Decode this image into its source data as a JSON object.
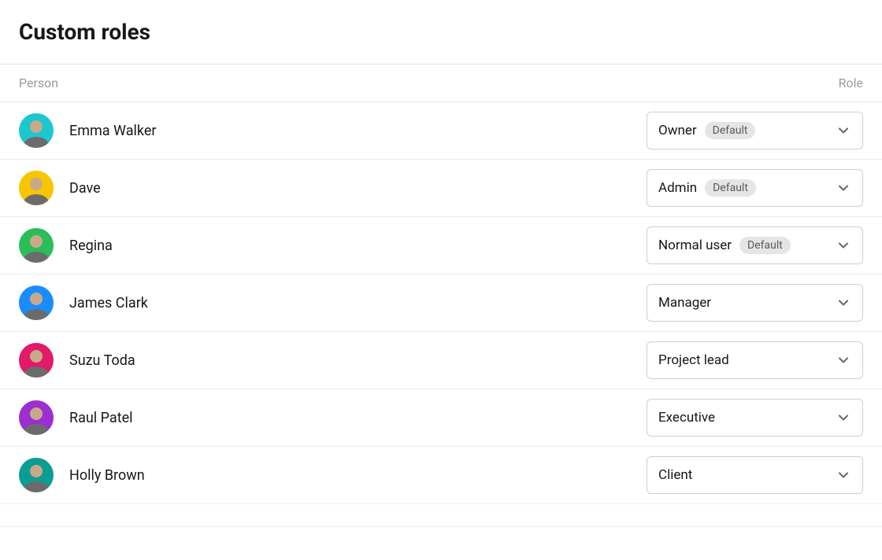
{
  "title": "Custom roles",
  "columns": {
    "person": "Person",
    "role": "Role"
  },
  "badge_default": "Default",
  "rows": [
    {
      "name": "Emma Walker",
      "role": "Owner",
      "default": true,
      "avatar_bg": "#1cc7d0"
    },
    {
      "name": "Dave",
      "role": "Admin",
      "default": true,
      "avatar_bg": "#f7c600"
    },
    {
      "name": "Regina",
      "role": "Normal user",
      "default": true,
      "avatar_bg": "#2bbd5a"
    },
    {
      "name": "James Clark",
      "role": "Manager",
      "default": false,
      "avatar_bg": "#1a8cff"
    },
    {
      "name": "Suzu Toda",
      "role": "Project lead",
      "default": false,
      "avatar_bg": "#e11a6a"
    },
    {
      "name": "Raul Patel",
      "role": "Executive",
      "default": false,
      "avatar_bg": "#9b2fcf"
    },
    {
      "name": "Holly Brown",
      "role": "Client",
      "default": false,
      "avatar_bg": "#0a9d93"
    }
  ]
}
